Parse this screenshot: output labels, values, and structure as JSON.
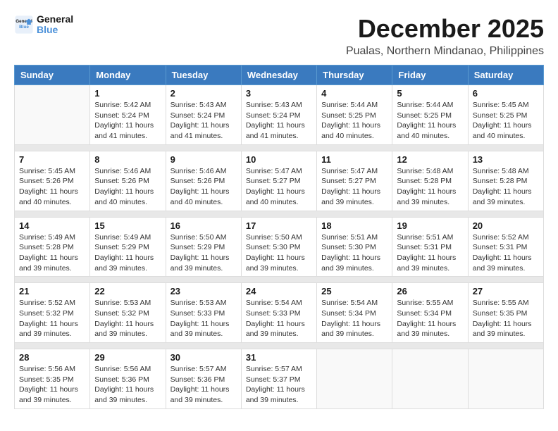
{
  "header": {
    "logo_line1": "General",
    "logo_line2": "Blue",
    "month": "December 2025",
    "location": "Pualas, Northern Mindanao, Philippines"
  },
  "weekdays": [
    "Sunday",
    "Monday",
    "Tuesday",
    "Wednesday",
    "Thursday",
    "Friday",
    "Saturday"
  ],
  "weeks": [
    [
      {
        "day": "",
        "sunrise": "",
        "sunset": "",
        "daylight": ""
      },
      {
        "day": "1",
        "sunrise": "5:42 AM",
        "sunset": "5:24 PM",
        "daylight": "11 hours and 41 minutes."
      },
      {
        "day": "2",
        "sunrise": "5:43 AM",
        "sunset": "5:24 PM",
        "daylight": "11 hours and 41 minutes."
      },
      {
        "day": "3",
        "sunrise": "5:43 AM",
        "sunset": "5:24 PM",
        "daylight": "11 hours and 41 minutes."
      },
      {
        "day": "4",
        "sunrise": "5:44 AM",
        "sunset": "5:25 PM",
        "daylight": "11 hours and 40 minutes."
      },
      {
        "day": "5",
        "sunrise": "5:44 AM",
        "sunset": "5:25 PM",
        "daylight": "11 hours and 40 minutes."
      },
      {
        "day": "6",
        "sunrise": "5:45 AM",
        "sunset": "5:25 PM",
        "daylight": "11 hours and 40 minutes."
      }
    ],
    [
      {
        "day": "7",
        "sunrise": "5:45 AM",
        "sunset": "5:26 PM",
        "daylight": "11 hours and 40 minutes."
      },
      {
        "day": "8",
        "sunrise": "5:46 AM",
        "sunset": "5:26 PM",
        "daylight": "11 hours and 40 minutes."
      },
      {
        "day": "9",
        "sunrise": "5:46 AM",
        "sunset": "5:26 PM",
        "daylight": "11 hours and 40 minutes."
      },
      {
        "day": "10",
        "sunrise": "5:47 AM",
        "sunset": "5:27 PM",
        "daylight": "11 hours and 40 minutes."
      },
      {
        "day": "11",
        "sunrise": "5:47 AM",
        "sunset": "5:27 PM",
        "daylight": "11 hours and 39 minutes."
      },
      {
        "day": "12",
        "sunrise": "5:48 AM",
        "sunset": "5:28 PM",
        "daylight": "11 hours and 39 minutes."
      },
      {
        "day": "13",
        "sunrise": "5:48 AM",
        "sunset": "5:28 PM",
        "daylight": "11 hours and 39 minutes."
      }
    ],
    [
      {
        "day": "14",
        "sunrise": "5:49 AM",
        "sunset": "5:28 PM",
        "daylight": "11 hours and 39 minutes."
      },
      {
        "day": "15",
        "sunrise": "5:49 AM",
        "sunset": "5:29 PM",
        "daylight": "11 hours and 39 minutes."
      },
      {
        "day": "16",
        "sunrise": "5:50 AM",
        "sunset": "5:29 PM",
        "daylight": "11 hours and 39 minutes."
      },
      {
        "day": "17",
        "sunrise": "5:50 AM",
        "sunset": "5:30 PM",
        "daylight": "11 hours and 39 minutes."
      },
      {
        "day": "18",
        "sunrise": "5:51 AM",
        "sunset": "5:30 PM",
        "daylight": "11 hours and 39 minutes."
      },
      {
        "day": "19",
        "sunrise": "5:51 AM",
        "sunset": "5:31 PM",
        "daylight": "11 hours and 39 minutes."
      },
      {
        "day": "20",
        "sunrise": "5:52 AM",
        "sunset": "5:31 PM",
        "daylight": "11 hours and 39 minutes."
      }
    ],
    [
      {
        "day": "21",
        "sunrise": "5:52 AM",
        "sunset": "5:32 PM",
        "daylight": "11 hours and 39 minutes."
      },
      {
        "day": "22",
        "sunrise": "5:53 AM",
        "sunset": "5:32 PM",
        "daylight": "11 hours and 39 minutes."
      },
      {
        "day": "23",
        "sunrise": "5:53 AM",
        "sunset": "5:33 PM",
        "daylight": "11 hours and 39 minutes."
      },
      {
        "day": "24",
        "sunrise": "5:54 AM",
        "sunset": "5:33 PM",
        "daylight": "11 hours and 39 minutes."
      },
      {
        "day": "25",
        "sunrise": "5:54 AM",
        "sunset": "5:34 PM",
        "daylight": "11 hours and 39 minutes."
      },
      {
        "day": "26",
        "sunrise": "5:55 AM",
        "sunset": "5:34 PM",
        "daylight": "11 hours and 39 minutes."
      },
      {
        "day": "27",
        "sunrise": "5:55 AM",
        "sunset": "5:35 PM",
        "daylight": "11 hours and 39 minutes."
      }
    ],
    [
      {
        "day": "28",
        "sunrise": "5:56 AM",
        "sunset": "5:35 PM",
        "daylight": "11 hours and 39 minutes."
      },
      {
        "day": "29",
        "sunrise": "5:56 AM",
        "sunset": "5:36 PM",
        "daylight": "11 hours and 39 minutes."
      },
      {
        "day": "30",
        "sunrise": "5:57 AM",
        "sunset": "5:36 PM",
        "daylight": "11 hours and 39 minutes."
      },
      {
        "day": "31",
        "sunrise": "5:57 AM",
        "sunset": "5:37 PM",
        "daylight": "11 hours and 39 minutes."
      },
      {
        "day": "",
        "sunrise": "",
        "sunset": "",
        "daylight": ""
      },
      {
        "day": "",
        "sunrise": "",
        "sunset": "",
        "daylight": ""
      },
      {
        "day": "",
        "sunrise": "",
        "sunset": "",
        "daylight": ""
      }
    ]
  ]
}
